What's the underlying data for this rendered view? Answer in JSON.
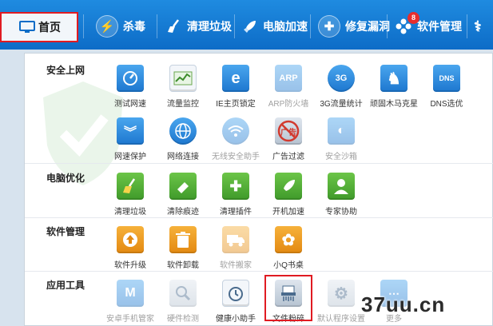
{
  "nav": {
    "tabs": [
      {
        "label": "首页",
        "icon": "monitor-icon"
      },
      {
        "label": "杀毒",
        "icon": "shield-scan-icon"
      },
      {
        "label": "清理垃圾",
        "icon": "broom-icon"
      },
      {
        "label": "电脑加速",
        "icon": "rocket-icon"
      },
      {
        "label": "修复漏洞",
        "icon": "patch-icon"
      },
      {
        "label": "软件管理",
        "icon": "apps-icon",
        "badge": "8"
      }
    ]
  },
  "sections": [
    {
      "title": "安全上网",
      "tools": [
        {
          "label": "测试网速",
          "icon": "speedometer-icon"
        },
        {
          "label": "流量监控",
          "icon": "traffic-monitor-icon"
        },
        {
          "label": "IE主页锁定",
          "icon": "ie-lock-icon"
        },
        {
          "label": "ARP防火墙",
          "icon": "arp-icon",
          "icon_text": "ARP"
        },
        {
          "label": "3G流量统计",
          "icon": "3g-icon",
          "icon_text": "3G"
        },
        {
          "label": "顽固木马克星",
          "icon": "chess-knight-icon"
        },
        {
          "label": "DNS选优",
          "icon": "dns-icon",
          "icon_text": "DNS"
        },
        {
          "label": "网速保护",
          "icon": "shield-chevron-icon"
        },
        {
          "label": "网络连接",
          "icon": "globe-icon"
        },
        {
          "label": "无线安全助手",
          "icon": "wifi-icon"
        },
        {
          "label": "广告过滤",
          "icon": "ad-block-icon",
          "icon_text": "广告"
        },
        {
          "label": "安全沙箱",
          "icon": "sandbox-icon"
        }
      ]
    },
    {
      "title": "电脑优化",
      "tools": [
        {
          "label": "清理垃圾",
          "icon": "broom-icon"
        },
        {
          "label": "清除痕迹",
          "icon": "eraser-icon"
        },
        {
          "label": "清理插件",
          "icon": "puzzle-icon"
        },
        {
          "label": "开机加速",
          "icon": "startup-icon"
        },
        {
          "label": "专家协助",
          "icon": "expert-icon"
        }
      ]
    },
    {
      "title": "软件管理",
      "tools": [
        {
          "label": "软件升级",
          "icon": "upgrade-icon"
        },
        {
          "label": "软件卸载",
          "icon": "trash-icon"
        },
        {
          "label": "软件搬家",
          "icon": "truck-icon"
        },
        {
          "label": "小Q书桌",
          "icon": "qdesk-icon"
        }
      ]
    },
    {
      "title": "应用工具",
      "tools": [
        {
          "label": "安卓手机管家",
          "icon": "android-manager-icon"
        },
        {
          "label": "硬件检测",
          "icon": "hardware-check-icon"
        },
        {
          "label": "健康小助手",
          "icon": "alarm-clock-icon"
        },
        {
          "label": "文件粉碎",
          "icon": "shredder-icon"
        },
        {
          "label": "默认程序设置",
          "icon": "gear-icon"
        },
        {
          "label": "更多",
          "icon": "more-icon"
        }
      ]
    }
  ],
  "watermark": {
    "text": "37uu.cn"
  }
}
